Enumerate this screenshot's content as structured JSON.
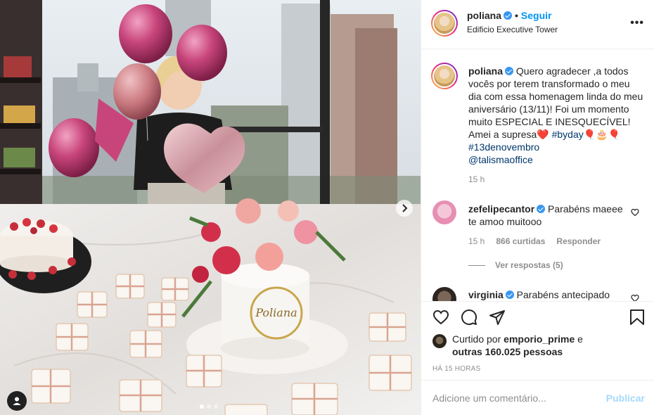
{
  "post": {
    "username": "poliana",
    "follow_label": "Seguir",
    "location": "Edificio Executive Tower",
    "more_label": "•••",
    "photo_cake_text": "Poliana",
    "carousel": {
      "total": 3,
      "active": 1
    }
  },
  "caption": {
    "username": "poliana",
    "text": " Quero agradecer ,a todos vocês por terem transformado o meu dia com essa homenagem linda do meu aniversário (13/11)! Foi um momento muito ESPECIAL E INESQUECÍVEL! Amei a supresa❤️ ",
    "hashtag1": "#byday",
    "emoji": "🎈🎂🎈",
    "hashtag2": "#13denovembro",
    "mention": "@talismaoffice",
    "time": "15 h"
  },
  "comments": [
    {
      "username": "zefelipecantor",
      "text": " Parabéns maeee te amoo muitooo",
      "time": "15 h",
      "likes": "866 curtidas",
      "reply": "Responder",
      "view_replies": "Ver respostas (5)"
    },
    {
      "username": "virginia",
      "text": " Parabéns antecipado"
    }
  ],
  "likes": {
    "prefix": "Curtido por ",
    "user": "emporio_prime",
    "connector": " e",
    "others": "outras 160.025 pessoas"
  },
  "posted_ago": "HÁ 15 HORAS",
  "add_comment": {
    "placeholder": "Adicione um comentário...",
    "publish_label": "Publicar"
  },
  "colors": {
    "accent": "#0095f6",
    "verified": "#3897f0",
    "text": "#262626",
    "muted": "#8e8e8e",
    "border": "#efefef"
  }
}
